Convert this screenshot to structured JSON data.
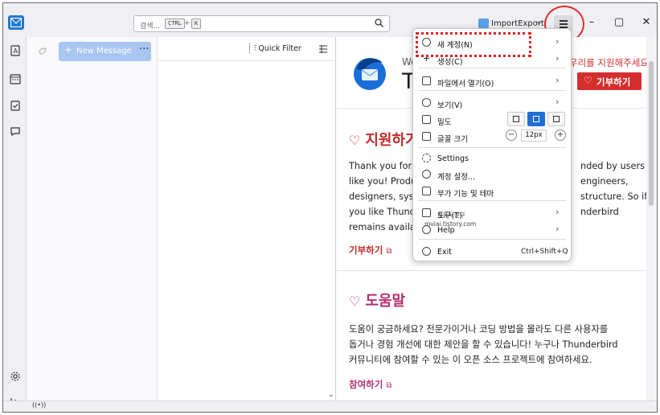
{
  "search": {
    "placeholder": "검색...",
    "key1": "CTRL",
    "plus": "+",
    "key2": "K"
  },
  "account": {
    "label": "ImportExport"
  },
  "folder_pane": {
    "new_message": "New Message",
    "more": "···"
  },
  "thread_pane": {
    "quick_filter": "Quick Filter"
  },
  "content": {
    "welcome_small": "We",
    "welcome_large": "Th",
    "support_text": "우리를 지원해주세요!",
    "donate_button": "기부하기",
    "section1_title": "지원하기",
    "section1_lines": [
      "Thank you for s",
      "like you! Produ",
      "designers, syst",
      "you like Thunde",
      "remains availab"
    ],
    "section1_lines_right": [
      "nded by users",
      "engineers,",
      "structure. So if",
      "nderbird",
      ""
    ],
    "section1_link": "기부하기",
    "section2_title": "도움말",
    "section2_lines": [
      "도움이 궁금하세요? 전문가이거나 코딩 방법을 몰라도 다른 사용자를",
      "돕거나 경험 개선에 대한 제안을 할 수 있습니다! 누구나 Thunderbird",
      "커뮤니티에 참여할 수 있는 이 오픈 소스 프로젝트에 참여하세요."
    ],
    "section2_link": "참여하기"
  },
  "menu": {
    "new_account": "새 계정(N)",
    "create": "생성(C)",
    "open_file": "파일에서 열기(O)",
    "view": "보기(V)",
    "density": "밀도",
    "font_size": "글꼴 크기",
    "font_size_value": "12px",
    "settings": "Settings",
    "account_settings": "계정 설정...",
    "addons": "부가 기능 및 테마",
    "tools": "도구(T)",
    "help": "Help",
    "exit": "Exit",
    "exit_shortcut": "Ctrl+Shift+Q"
  },
  "watermark": {
    "line1": "컴퓨터친구",
    "line2": "mviai.tistory.com"
  },
  "colors": {
    "accent": "#1f6fd6",
    "donate": "#d32f2f",
    "help": "#b2306e",
    "annotation": "#e22a2a"
  }
}
